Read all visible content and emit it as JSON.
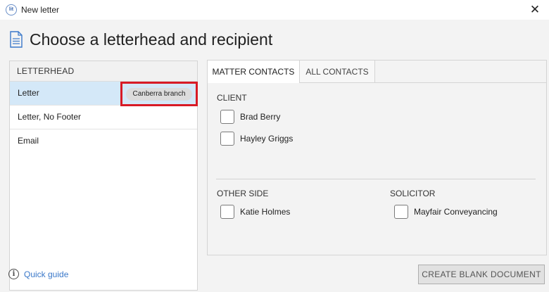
{
  "window": {
    "title": "New letter",
    "app_icon": "app-logo-icon",
    "close_glyph": "✕"
  },
  "page": {
    "title": "Choose a letterhead and recipient",
    "icon": "document-icon"
  },
  "letterhead": {
    "header": "LETTERHEAD",
    "items": [
      {
        "label": "Letter",
        "selected": true,
        "branch": "Canberra branch"
      },
      {
        "label": "Letter, No Footer",
        "selected": false
      },
      {
        "label": "Email",
        "selected": false
      }
    ]
  },
  "contacts": {
    "tabs": [
      {
        "label": "MATTER CONTACTS",
        "active": true
      },
      {
        "label": "ALL CONTACTS",
        "active": false
      }
    ],
    "client": {
      "label": "CLIENT",
      "people": [
        "Brad Berry",
        "Hayley Griggs"
      ]
    },
    "other_side": {
      "label": "OTHER SIDE",
      "people": [
        "Katie Holmes"
      ]
    },
    "solicitor": {
      "label": "SOLICITOR",
      "people": [
        "Mayfair Conveyancing"
      ]
    }
  },
  "footer": {
    "quick_guide": "Quick guide",
    "info_glyph": "i",
    "create_button": "CREATE BLANK DOCUMENT"
  },
  "colors": {
    "accent_link": "#3a78c9",
    "selection": "#d4e8f8",
    "highlight_outline": "#d81b26"
  }
}
